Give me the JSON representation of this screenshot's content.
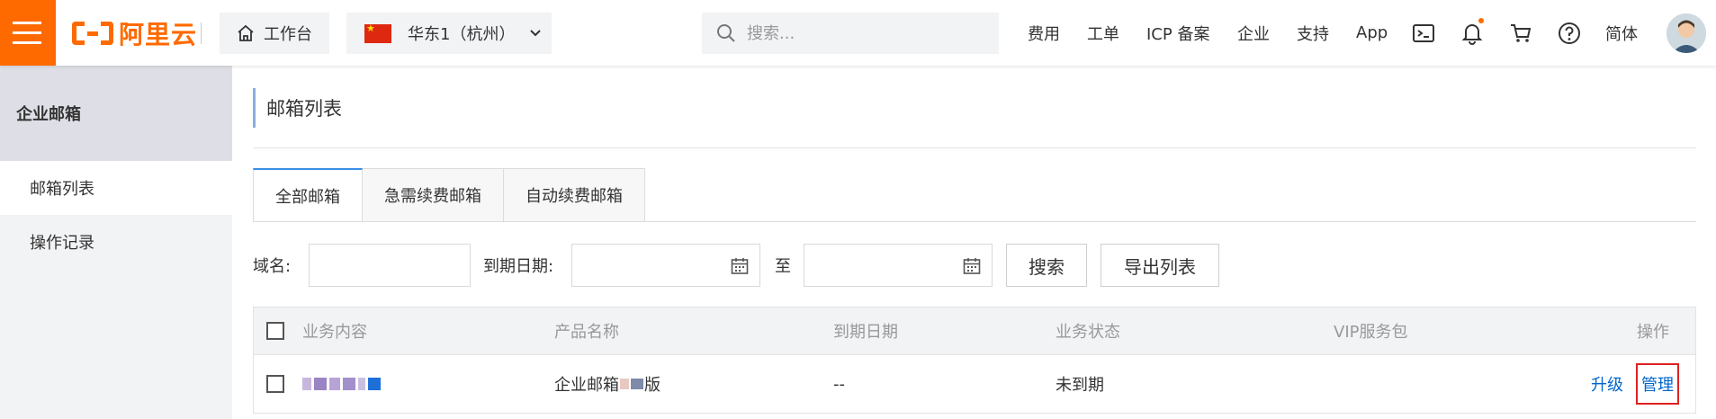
{
  "header": {
    "logo_text": "阿里云",
    "workbench_label": "工作台",
    "region_label": "华东1（杭州）",
    "search_placeholder": "搜索...",
    "nav": [
      "费用",
      "工单",
      "ICP 备案",
      "企业",
      "支持",
      "App"
    ],
    "lang_label": "简体"
  },
  "sidebar": {
    "title": "企业邮箱",
    "items": [
      {
        "label": "邮箱列表",
        "active": true
      },
      {
        "label": "操作记录",
        "active": false
      }
    ]
  },
  "main": {
    "page_title": "邮箱列表",
    "tabs": [
      {
        "label": "全部邮箱",
        "active": true
      },
      {
        "label": "急需续费邮箱",
        "active": false
      },
      {
        "label": "自动续费邮箱",
        "active": false
      }
    ],
    "filters": {
      "domain_label": "域名:",
      "expiry_label": "到期日期:",
      "to_label": "至",
      "search_button": "搜索",
      "export_button": "导出列表"
    },
    "table": {
      "columns": [
        "业务内容",
        "产品名称",
        "到期日期",
        "业务状态",
        "VIP服务包",
        "操作"
      ],
      "rows": [
        {
          "product_prefix": "企业邮箱",
          "product_suffix": "版",
          "expiry": "--",
          "status": "未到期",
          "actions": [
            "升级",
            "管理"
          ]
        }
      ]
    }
  },
  "colors": {
    "brand": "#ff6a00",
    "link": "#0066cc",
    "highlight": "#e02020"
  }
}
